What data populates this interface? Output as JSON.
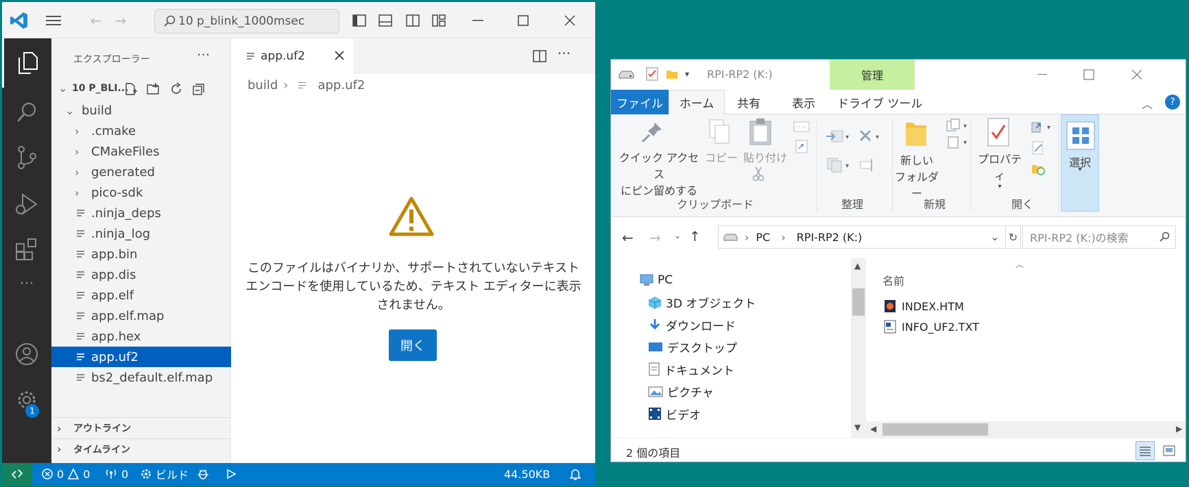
{
  "vscode": {
    "search_text": "10 p_blink_1000msec",
    "sidebar": {
      "title": "エクスプローラー",
      "folder_name": "10 P_BLI...",
      "tree": [
        {
          "label": "build",
          "kind": "folder-open",
          "level": 0
        },
        {
          "label": ".cmake",
          "kind": "folder",
          "level": 1
        },
        {
          "label": "CMakeFiles",
          "kind": "folder",
          "level": 1
        },
        {
          "label": "generated",
          "kind": "folder",
          "level": 1
        },
        {
          "label": "pico-sdk",
          "kind": "folder",
          "level": 1
        },
        {
          "label": ".ninja_deps",
          "kind": "file",
          "level": 1
        },
        {
          "label": ".ninja_log",
          "kind": "file",
          "level": 1
        },
        {
          "label": "app.bin",
          "kind": "file",
          "level": 1
        },
        {
          "label": "app.dis",
          "kind": "file",
          "level": 1
        },
        {
          "label": "app.elf",
          "kind": "file",
          "level": 1
        },
        {
          "label": "app.elf.map",
          "kind": "file",
          "level": 1
        },
        {
          "label": "app.hex",
          "kind": "file",
          "level": 1
        },
        {
          "label": "app.uf2",
          "kind": "file",
          "level": 1,
          "selected": true
        },
        {
          "label": "bs2_default.elf.map",
          "kind": "file",
          "level": 1
        }
      ],
      "outline": "アウトライン",
      "timeline": "タイムライン"
    },
    "editor": {
      "tab_label": "app.uf2",
      "breadcrumb": [
        "build",
        "app.uf2"
      ],
      "message": "このファイルはバイナリか、サポートされていないテキスト エンコードを使用しているため、テキスト エディターに表示されません。",
      "open_button": "開く"
    },
    "status": {
      "errors": "0",
      "warnings": "0",
      "ports": "0",
      "build": "ビルド",
      "size": "44.50KB",
      "badge": "1"
    }
  },
  "explorer": {
    "window_title": "RPI-RP2 (K:)",
    "manage_label": "管理",
    "tabs": [
      "ファイル",
      "ホーム",
      "共有",
      "表示",
      "ドライブ ツール"
    ],
    "ribbon": {
      "pin_label_1": "クイック アクセス",
      "pin_label_2": "にピン留めする",
      "copy": "コピー",
      "paste": "貼り付け",
      "new_folder_1": "新しい",
      "new_folder_2": "フォルダー",
      "properties": "プロパティ",
      "select": "選択",
      "groups": [
        "クリップボード",
        "整理",
        "新規",
        "開く"
      ]
    },
    "address": [
      "PC",
      "RPI-RP2 (K:)"
    ],
    "search_placeholder": "RPI-RP2 (K:)の検索",
    "nav": [
      "PC",
      "3D オブジェクト",
      "ダウンロード",
      "デスクトップ",
      "ドキュメント",
      "ピクチャ",
      "ビデオ"
    ],
    "column_header": "名前",
    "files": [
      "INDEX.HTM",
      "INFO_UF2.TXT"
    ],
    "status": "2 個の項目"
  },
  "colors": {
    "vscode_accent": "#007acc",
    "selection": "#0060c0",
    "teal_desktop": "#008080",
    "ribbon_file_tab": "#1979ca",
    "manage_tab": "#c6efa0"
  }
}
